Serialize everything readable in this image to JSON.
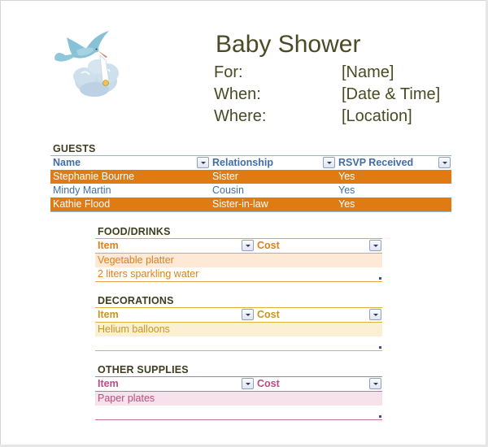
{
  "header": {
    "title": "Baby Shower",
    "fields": [
      {
        "label": "For:",
        "value": "[Name]"
      },
      {
        "label": "When:",
        "value": "[Date & Time]"
      },
      {
        "label": "Where:",
        "value": "[Location]"
      }
    ],
    "illustration": "stork-carrying-baby-bundle-icon"
  },
  "guests": {
    "title": "GUESTS",
    "columns": [
      "Name",
      "Relationship",
      "RSVP Received"
    ],
    "rows": [
      [
        "Stephanie Bourne",
        "Sister",
        "Yes"
      ],
      [
        "Mindy Martin",
        "Cousin",
        "Yes"
      ],
      [
        "Kathie Flood",
        "Sister-in-law",
        "Yes"
      ]
    ],
    "colors": {
      "band": "#e07b13",
      "text": "#3f6ea6",
      "border": "#95b3d7"
    }
  },
  "food": {
    "title": "FOOD/DRINKS",
    "columns": [
      "Item",
      "Cost"
    ],
    "rows": [
      [
        "Vegetable platter",
        ""
      ],
      [
        "2 liters sparkling water",
        ""
      ]
    ],
    "colors": {
      "accent": "#e0801a",
      "band": "#fde9d6"
    }
  },
  "decorations": {
    "title": "DECORATIONS",
    "columns": [
      "Item",
      "Cost"
    ],
    "rows": [
      [
        "Helium balloons",
        ""
      ],
      [
        "",
        ""
      ]
    ],
    "colors": {
      "accent": "#c8951e",
      "band": "#fcf0d4"
    }
  },
  "other_supplies": {
    "title": "OTHER SUPPLIES",
    "columns": [
      "Item",
      "Cost"
    ],
    "rows": [
      [
        "Paper plates",
        ""
      ],
      [
        "",
        ""
      ]
    ],
    "colors": {
      "accent": "#b84e80",
      "band": "#f7e1ea"
    }
  },
  "icons": {
    "filter_dropdown": "filter-dropdown-icon",
    "table_resize": "table-resize-handle-icon"
  }
}
